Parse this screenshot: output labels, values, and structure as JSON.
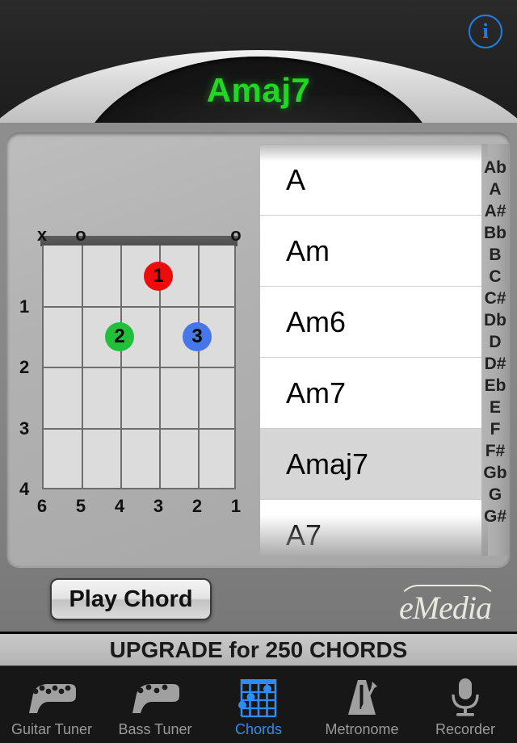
{
  "header": {
    "chord_title": "Amaj7",
    "info_label": "i",
    "info_icon": "info-circle-icon"
  },
  "diagram": {
    "top_markers": [
      {
        "string": 6,
        "symbol": "x"
      },
      {
        "string": 5,
        "symbol": "o"
      },
      {
        "string": 1,
        "symbol": "o"
      }
    ],
    "fret_numbers": [
      "1",
      "2",
      "3",
      "4"
    ],
    "string_numbers": [
      "6",
      "5",
      "4",
      "3",
      "2",
      "1"
    ],
    "fingers": [
      {
        "label": "1",
        "string": 3,
        "fret": 1,
        "color": "#ee0b0b"
      },
      {
        "label": "2",
        "string": 4,
        "fret": 2,
        "color": "#22c03a"
      },
      {
        "label": "3",
        "string": 2,
        "fret": 2,
        "color": "#4577e8"
      }
    ]
  },
  "chord_list": {
    "items": [
      {
        "name": "A",
        "selected": false
      },
      {
        "name": "Am",
        "selected": false
      },
      {
        "name": "Am6",
        "selected": false
      },
      {
        "name": "Am7",
        "selected": false
      },
      {
        "name": "Amaj7",
        "selected": true
      },
      {
        "name": "A7",
        "selected": false
      }
    ]
  },
  "index_bar": {
    "letters": [
      "Ab",
      "A",
      "A#",
      "Bb",
      "B",
      "C",
      "C#",
      "Db",
      "D",
      "D#",
      "Eb",
      "E",
      "F",
      "F#",
      "Gb",
      "G",
      "G#"
    ]
  },
  "controls": {
    "play_chord_label": "Play Chord",
    "brand_logo": "eMedia",
    "upgrade_label": "UPGRADE for 250 CHORDS"
  },
  "tabbar": {
    "tabs": [
      {
        "label": "Guitar Tuner",
        "icon": "guitar-headstock-icon",
        "active": false
      },
      {
        "label": "Bass Tuner",
        "icon": "bass-headstock-icon",
        "active": false
      },
      {
        "label": "Chords",
        "icon": "chord-grid-icon",
        "active": true
      },
      {
        "label": "Metronome",
        "icon": "metronome-icon",
        "active": false
      },
      {
        "label": "Recorder",
        "icon": "microphone-icon",
        "active": false
      }
    ]
  },
  "colors": {
    "accent_blue": "#2f8cf0",
    "screen_green": "#22d723",
    "selected_row": "#d6d6d6"
  }
}
